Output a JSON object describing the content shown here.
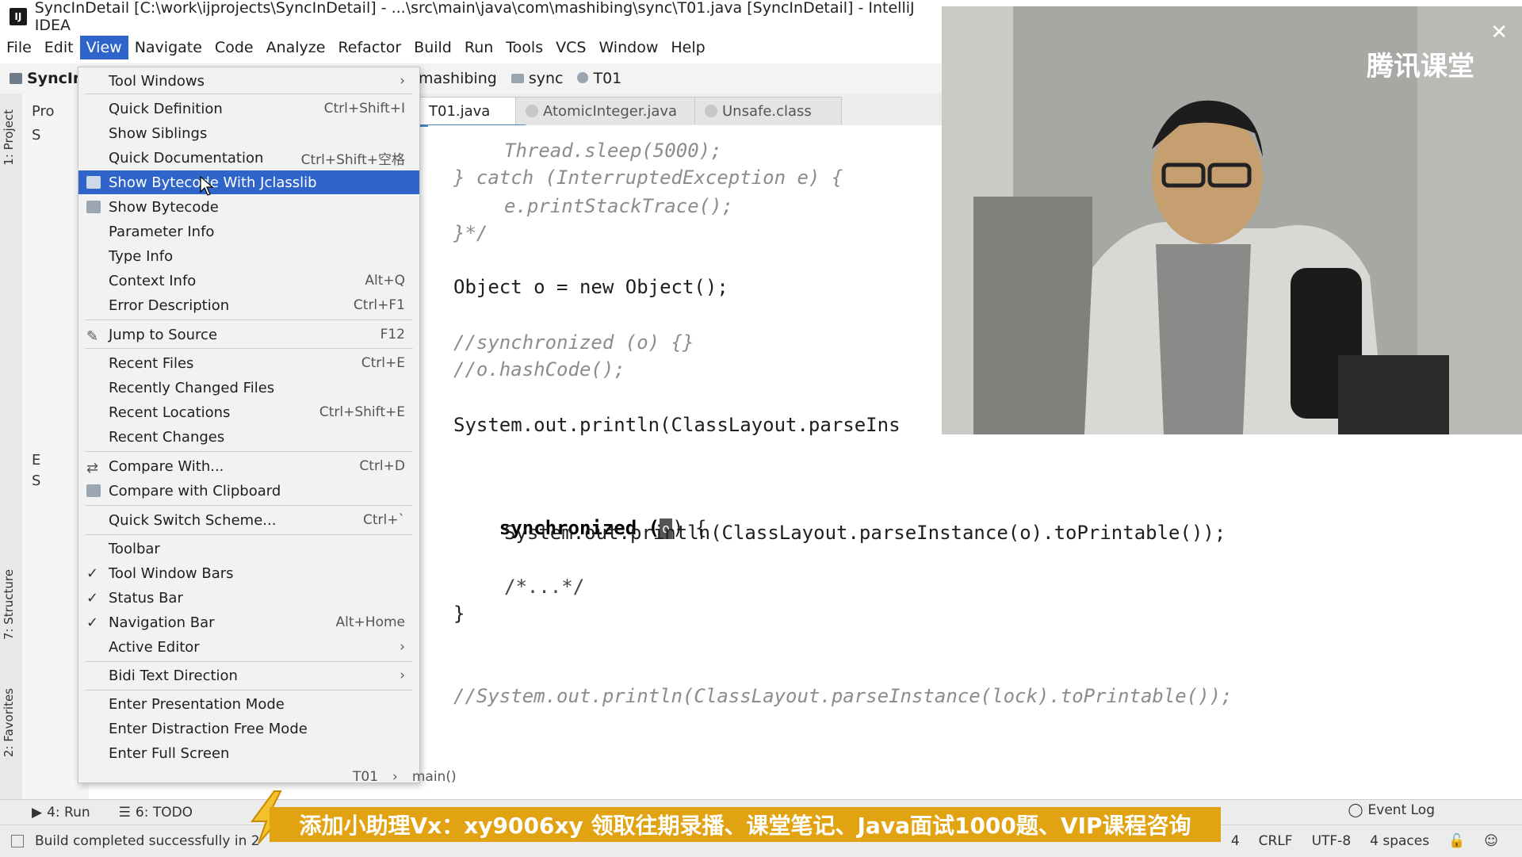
{
  "window": {
    "title": "SyncInDetail [C:\\work\\ijprojects\\SyncInDetail] - ...\\src\\main\\java\\com\\mashibing\\sync\\T01.java [SyncInDetail] - IntelliJ IDEA"
  },
  "menu_bar": [
    "File",
    "Edit",
    "View",
    "Navigate",
    "Code",
    "Analyze",
    "Refactor",
    "Build",
    "Run",
    "Tools",
    "VCS",
    "Window",
    "Help"
  ],
  "nav_bar": {
    "root": "SyncIn",
    "crumbs": [
      "mashibing",
      "sync",
      "T01"
    ]
  },
  "tabs": [
    "T01.java",
    "AtomicInteger.java",
    "Unsafe.class"
  ],
  "left_panel": {
    "strip_top": "1: Project",
    "strip_mid": "7: Structure",
    "strip_bottom": "2: Favorites",
    "project_label": "Pro",
    "tree_items": [
      "S",
      "E",
      "S"
    ]
  },
  "view_menu": {
    "items": [
      {
        "label": "Tool Windows",
        "shortcut": "",
        "submenu": true
      },
      {
        "label": "Quick Definition",
        "shortcut": "Ctrl+Shift+I"
      },
      {
        "label": "Show Siblings",
        "shortcut": ""
      },
      {
        "label": "Quick Documentation",
        "shortcut": "Ctrl+Shift+空格"
      },
      {
        "label": "Show Bytecode With Jclasslib",
        "shortcut": "",
        "highlighted": true
      },
      {
        "label": "Show Bytecode",
        "shortcut": ""
      },
      {
        "label": "Parameter Info",
        "shortcut": ""
      },
      {
        "label": "Type Info",
        "shortcut": ""
      },
      {
        "label": "Context Info",
        "shortcut": "Alt+Q"
      },
      {
        "label": "Error Description",
        "shortcut": "Ctrl+F1"
      },
      {
        "label": "Jump to Source",
        "shortcut": "F12"
      },
      {
        "label": "Recent Files",
        "shortcut": "Ctrl+E"
      },
      {
        "label": "Recently Changed Files",
        "shortcut": ""
      },
      {
        "label": "Recent Locations",
        "shortcut": "Ctrl+Shift+E"
      },
      {
        "label": "Recent Changes",
        "shortcut": ""
      },
      {
        "label": "Compare With...",
        "shortcut": "Ctrl+D"
      },
      {
        "label": "Compare with Clipboard",
        "shortcut": ""
      },
      {
        "label": "Quick Switch Scheme...",
        "shortcut": "Ctrl+`"
      },
      {
        "label": "Toolbar",
        "shortcut": ""
      },
      {
        "label": "Tool Window Bars",
        "shortcut": "",
        "checked": true
      },
      {
        "label": "Status Bar",
        "shortcut": "",
        "checked": true
      },
      {
        "label": "Navigation Bar",
        "shortcut": "Alt+Home",
        "checked": true
      },
      {
        "label": "Active Editor",
        "shortcut": "",
        "submenu": true
      },
      {
        "label": "Bidi Text Direction",
        "shortcut": "",
        "submenu": true
      },
      {
        "label": "Enter Presentation Mode",
        "shortcut": ""
      },
      {
        "label": "Enter Distraction Free Mode",
        "shortcut": ""
      },
      {
        "label": "Enter Full Screen",
        "shortcut": ""
      }
    ]
  },
  "code": {
    "lines": [
      "Thread.sleep(5000);",
      "} catch (InterruptedException e) {",
      "e.printStackTrace();",
      "}*/",
      "Object o = new Object();",
      "//synchronized (o) {}",
      "//o.hashCode();",
      "System.out.println(ClassLayout.parseIns",
      "synchronized (",
      ") {",
      "System.out.println(ClassLayout.parseInstance(o).toPrintable());",
      "/*...*/",
      "}",
      "//System.out.println(ClassLayout.parseInstance(lock).toPrintable());"
    ],
    "lock_char": "o"
  },
  "editor_breadcrumb": [
    "T01",
    "main()"
  ],
  "bottom_tools": [
    "4: Run",
    "6: TODO"
  ],
  "event_log": "Event Log",
  "status": {
    "message": "Build completed successfully in 2",
    "line_sep": "CRLF",
    "encoding": "UTF-8",
    "indent": "4 spaces",
    "col": "4"
  },
  "banner": {
    "text": "添加小助理Vx：xy9006xy 领取往期录播、课堂笔记、Java面试1000题、VIP课程咨询"
  },
  "webcam": {
    "watermark": "腾讯课堂"
  },
  "colors": {
    "menu_highlight": "#2f65ca",
    "banner": "#e2a312"
  }
}
